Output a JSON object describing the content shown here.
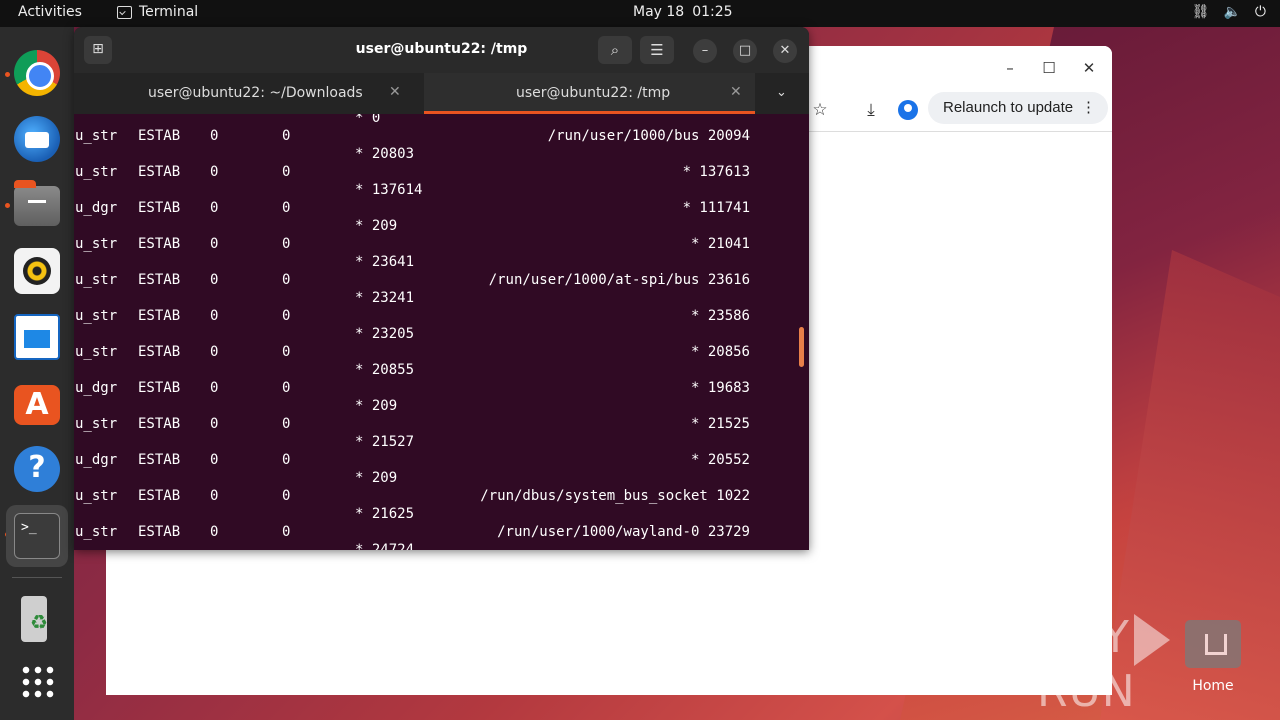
{
  "topbar": {
    "activities": "Activities",
    "app_name": "Terminal",
    "date": "May 18",
    "time": "01:25"
  },
  "dock": {
    "items": [
      "chrome",
      "thunderbird",
      "files",
      "rhythmbox",
      "libreoffice-impress",
      "app-center",
      "help",
      "terminal",
      "trash",
      "show-apps"
    ]
  },
  "browser": {
    "relaunch_label": "Relaunch to update",
    "menu_glyph": "⋮"
  },
  "terminal": {
    "window_title": "user@ubuntu22: /tmp",
    "tabs": [
      {
        "label": "user@ubuntu22: ~/Downloads",
        "active": false
      },
      {
        "label": "user@ubuntu22: /tmp",
        "active": true
      }
    ],
    "top_partial": "* 0",
    "rows": [
      {
        "netid": "u_str",
        "state": "ESTAB",
        "recv": "0",
        "send": "0",
        "local": "/run/user/1000/bus 20094",
        "peer": "* 20803"
      },
      {
        "netid": "u_str",
        "state": "ESTAB",
        "recv": "0",
        "send": "0",
        "local": "* 137613",
        "peer": "* 137614"
      },
      {
        "netid": "u_dgr",
        "state": "ESTAB",
        "recv": "0",
        "send": "0",
        "local": "* 111741",
        "peer": "* 209"
      },
      {
        "netid": "u_str",
        "state": "ESTAB",
        "recv": "0",
        "send": "0",
        "local": "* 21041",
        "peer": "* 23641"
      },
      {
        "netid": "u_str",
        "state": "ESTAB",
        "recv": "0",
        "send": "0",
        "local": "/run/user/1000/at-spi/bus 23616",
        "peer": "* 23241"
      },
      {
        "netid": "u_str",
        "state": "ESTAB",
        "recv": "0",
        "send": "0",
        "local": "* 23586",
        "peer": "* 23205"
      },
      {
        "netid": "u_str",
        "state": "ESTAB",
        "recv": "0",
        "send": "0",
        "local": "* 20856",
        "peer": "* 20855"
      },
      {
        "netid": "u_dgr",
        "state": "ESTAB",
        "recv": "0",
        "send": "0",
        "local": "* 19683",
        "peer": "* 209"
      },
      {
        "netid": "u_str",
        "state": "ESTAB",
        "recv": "0",
        "send": "0",
        "local": "* 21525",
        "peer": "* 21527"
      },
      {
        "netid": "u_dgr",
        "state": "ESTAB",
        "recv": "0",
        "send": "0",
        "local": "* 20552",
        "peer": "* 209"
      },
      {
        "netid": "u_str",
        "state": "ESTAB",
        "recv": "0",
        "send": "0",
        "local": "/run/dbus/system_bus_socket 1022",
        "peer": "* 21625"
      },
      {
        "netid": "u_str",
        "state": "ESTAB",
        "recv": "0",
        "send": "0",
        "local": "/run/user/1000/wayland-0 23729",
        "peer": "* 24724"
      }
    ]
  },
  "desktop": {
    "home_label": "Home"
  },
  "watermark": "ANY RUN",
  "colors": {
    "terminal_bg": "#300a24",
    "accent": "#e95420"
  }
}
